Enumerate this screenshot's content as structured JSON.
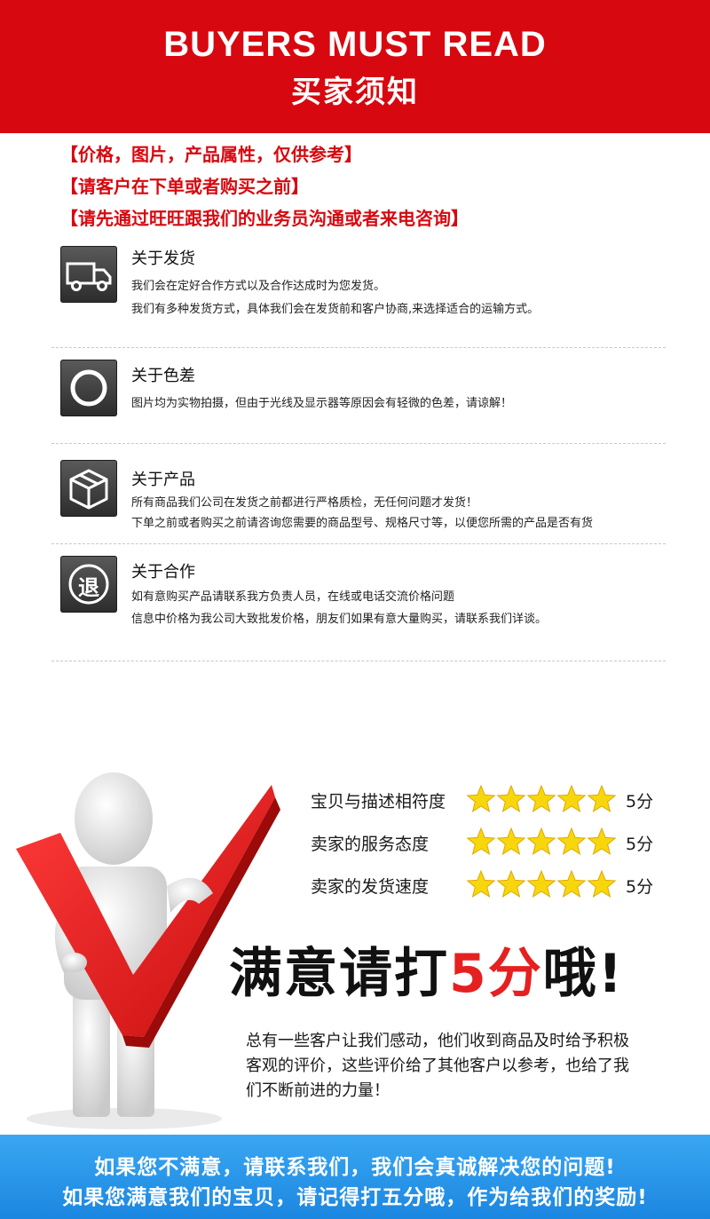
{
  "banner": {
    "title_en": "BUYERS MUST READ",
    "title_cn": "买家须知"
  },
  "notices": [
    "【价格，图片，产品属性，仅供参考】",
    "【请客户在下单或者购买之前】",
    "【请先通过旺旺跟我们的业务员沟通或者来电咨询】"
  ],
  "sections": [
    {
      "icon": "truck-icon",
      "title": "关于发货",
      "lines": [
        "我们会在定好合作方式以及合作达成时为您发货。",
        "我们有多种发货方式，具体我们会在发货前和客户协商,来选择适合的运输方式。"
      ]
    },
    {
      "icon": "circle-icon",
      "title": "关于色差",
      "lines": [
        "图片均为实物拍摄，但由于光线及显示器等原因会有轻微的色差，请谅解！"
      ]
    },
    {
      "icon": "box-icon",
      "title": "关于产品",
      "lines": [
        "所有商品我们公司在发货之前都进行严格质检，无任何问题才发货！",
        "下单之前或者购买之前请咨询您需要的商品型号、规格尺寸等，以便您所需的产品是否有货"
      ]
    },
    {
      "icon": "return-icon",
      "icon_glyph": "退",
      "title": "关于合作",
      "lines": [
        "如有意购买产品请联系我方负责人员，在线或电话交流价格问题",
        "信息中价格为我公司大致批发价格，朋友们如果有意大量购买，请联系我们详谈。"
      ]
    }
  ],
  "ratings": [
    {
      "label": "宝贝与描述相符度",
      "stars": 5,
      "score": "5分"
    },
    {
      "label": "卖家的服务态度",
      "stars": 5,
      "score": "5分"
    },
    {
      "label": "卖家的发货速度",
      "stars": 5,
      "score": "5分"
    }
  ],
  "headline": {
    "before": "满意请打",
    "highlight": "5分",
    "after": "哦!"
  },
  "praise": [
    "总有一些客户让我们感动，他们收到商品及时给予积极",
    "客观的评价，这些评价给了其他客户以参考，也给了我",
    "们不断前进的力量！"
  ],
  "footer": [
    "如果您不满意，请联系我们，我们会真诚解决您的问题!",
    "如果您满意我们的宝贝，请记得打五分哦，作为给我们的奖励!"
  ],
  "colors": {
    "banner_red": "#d7080f",
    "notice_red": "#d7080f",
    "star_yellow": "#f7d70c",
    "footer_blue": "#2896e8",
    "highlight_red": "#e52020"
  }
}
